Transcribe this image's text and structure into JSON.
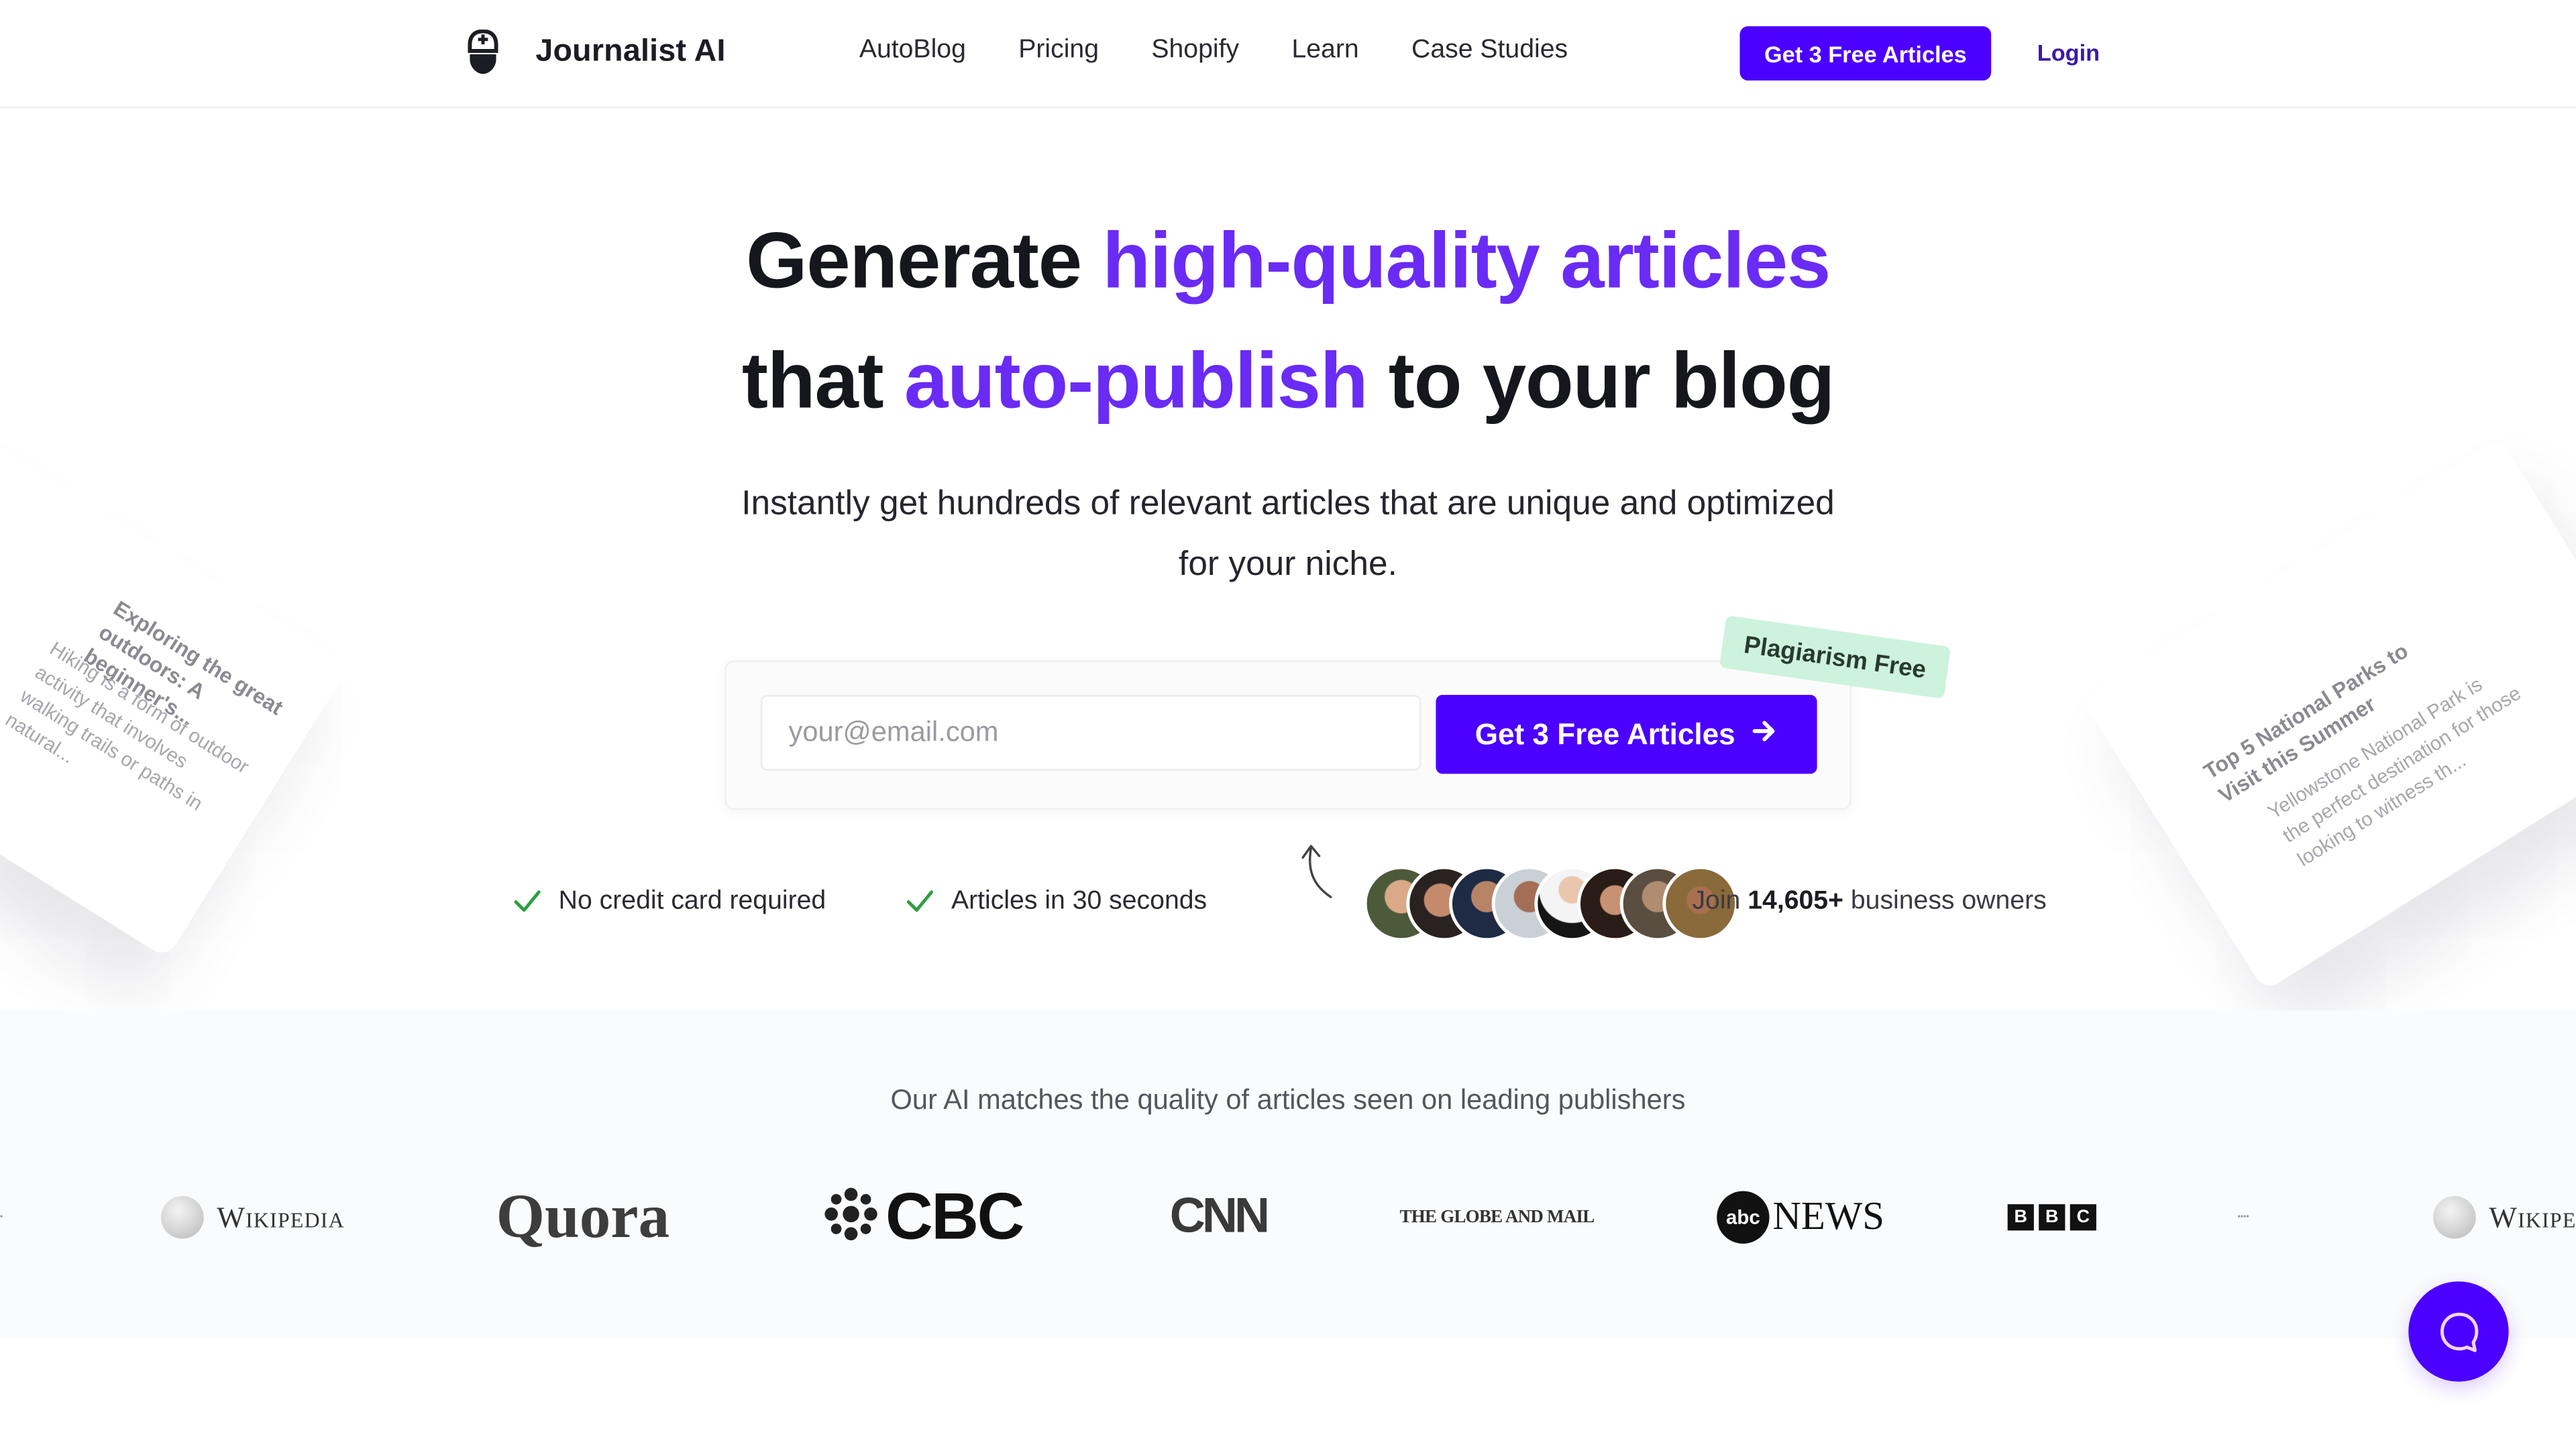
{
  "header": {
    "brand": "Journalist AI",
    "nav": [
      "AutoBlog",
      "Pricing",
      "Shopify",
      "Learn",
      "Case Studies"
    ],
    "cta_label": "Get 3 Free Articles",
    "login_label": "Login"
  },
  "hero": {
    "line1_plain": "Generate ",
    "line1_accent": "high-quality articles",
    "line2_plain_a": "that ",
    "line2_accent": "auto-publish",
    "line2_plain_b": " to your blog",
    "subtitle_line1": "Instantly get hundreds of relevant articles that are unique and optimized",
    "subtitle_line2": "for your niche."
  },
  "cards": {
    "left": {
      "title": "Exploring the great outdoors: A beginner's...",
      "body": "Hiking is a form of outdoor activity that involves walking trails or paths in natural..."
    },
    "right": {
      "title": "Top 5 National Parks to Visit this Summer",
      "body": "Yellowstone National Park is the perfect destination for those looking to witness th..."
    }
  },
  "form": {
    "email_placeholder": "your@email.com",
    "email_value": "",
    "cta_label": "Get 3 Free Articles",
    "badge": "Plagiarism Free"
  },
  "perks": [
    "No credit card required",
    "Articles in 30 seconds"
  ],
  "social_proof": {
    "prefix": "Join ",
    "count": "14,605+",
    "suffix": " business owners",
    "avatar_count": 8
  },
  "publishers": {
    "title": "Our AI matches the quality of articles seen on leading publishers",
    "logos": [
      "Wikipedia",
      "Quora",
      "CBC",
      "CNN",
      "The Globe and Mail",
      "abc NEWS",
      "BBC",
      "Wikipedia"
    ]
  },
  "colors": {
    "accent": "#4c00ff",
    "headline_accent": "#6a2bf5",
    "badge_bg": "#cdf3dc",
    "check": "#2e9e3f"
  }
}
